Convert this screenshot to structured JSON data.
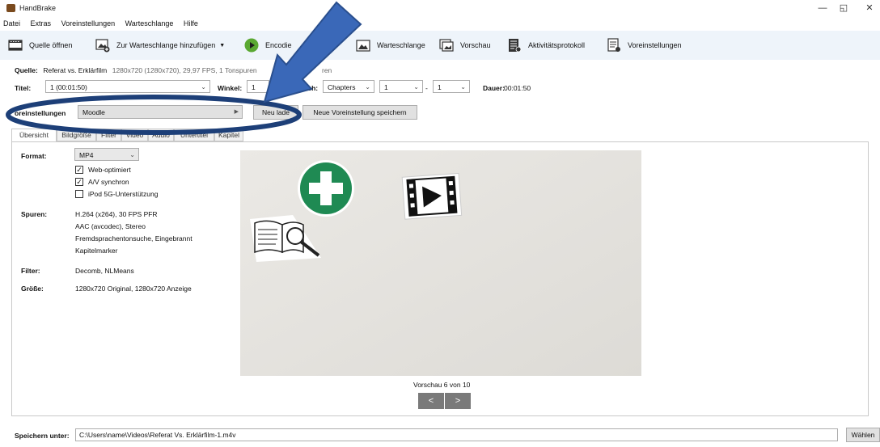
{
  "window": {
    "title": "HandBrake",
    "minimize": "—",
    "maximize": "◱",
    "close": "✕"
  },
  "menu": {
    "items": [
      "Datei",
      "Extras",
      "Voreinstellungen",
      "Warteschlange",
      "Hilfe"
    ]
  },
  "toolbar": {
    "open_source": "Quelle öffnen",
    "add_to_queue": "Zur Warteschlange hinzufügen",
    "encode": "Encodie",
    "queue": "Warteschlange",
    "preview": "Vorschau",
    "activity_log": "Aktivitätsprotokoll",
    "presets": "Voreinstellungen"
  },
  "source": {
    "label": "Quelle:",
    "name": "Referat vs. Erklärfilm",
    "info": "1280x720 (1280x720), 29,97 FPS, 1 Tonspuren",
    "info_tail": "ren"
  },
  "title_row": {
    "title_label": "Titel:",
    "title_value": "1 (00:01:50)",
    "angle_label": "Winkel:",
    "angle_value": "1",
    "range_label": "ich:",
    "range_mode": "Chapters",
    "range_from": "1",
    "range_dash": "-",
    "range_to": "1",
    "duration_label": "Dauer:",
    "duration_value": "00:01:50"
  },
  "presets_row": {
    "label": "oreinstellungen",
    "selected": "Moodle",
    "reload_button": "Neu lade",
    "save_new_button": "Neue Voreinstellung speichern"
  },
  "tabs": [
    "Übersicht",
    "Bildgröße",
    "Filter",
    "Video",
    "Audio",
    "Untertitel",
    "Kapitel"
  ],
  "summary": {
    "format_label": "Format:",
    "format_value": "MP4",
    "web_optimized": "Web-optimiert",
    "av_sync": "A/V synchron",
    "ipod": "iPod 5G-Unterstützung",
    "tracks_label": "Spuren:",
    "tracks": [
      "H.264 (x264), 30 FPS PFR",
      "AAC (avcodec), Stereo",
      "Fremdsprachentonsuche, Eingebrannt",
      "Kapitelmarker"
    ],
    "filters_label": "Filter:",
    "filters_value": "Decomb, NLMeans",
    "size_label": "Größe:",
    "size_value": "1280x720 Original, 1280x720 Anzeige"
  },
  "checkboxes": {
    "web_optimized": true,
    "av_sync": true,
    "ipod": false
  },
  "preview": {
    "caption": "Vorschau 6 von 10",
    "prev": "<",
    "next": ">"
  },
  "save_row": {
    "label": "Speichern unter:",
    "path": "C:\\Users\\name\\Videos\\Referat Vs. Erklärfilm-1.m4v",
    "browse_button": "Wählen"
  },
  "annotation": {
    "color": "#1d3f78",
    "arrow_color": "#3a68b8"
  }
}
